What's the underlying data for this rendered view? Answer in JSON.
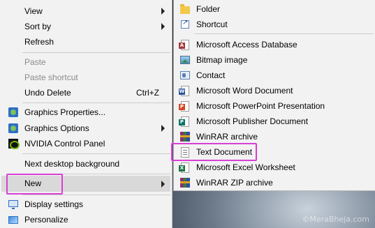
{
  "main_menu": {
    "items": [
      {
        "label": "View",
        "submenu": true
      },
      {
        "label": "Sort by",
        "submenu": true
      },
      {
        "label": "Refresh"
      },
      {
        "label": "Paste",
        "disabled": true
      },
      {
        "label": "Paste shortcut",
        "disabled": true
      },
      {
        "label": "Undo Delete",
        "shortcut": "Ctrl+Z"
      },
      {
        "label": "Graphics Properties...",
        "icon": "graphics-properties-icon"
      },
      {
        "label": "Graphics Options",
        "icon": "graphics-options-icon",
        "submenu": true
      },
      {
        "label": "NVIDIA Control Panel",
        "icon": "nvidia-icon"
      },
      {
        "label": "Next desktop background"
      },
      {
        "label": "New",
        "submenu": true,
        "highlighted": true
      },
      {
        "label": "Display settings",
        "icon": "display-settings-icon"
      },
      {
        "label": "Personalize",
        "icon": "personalize-icon"
      }
    ]
  },
  "new_submenu": {
    "items": [
      {
        "label": "Folder",
        "icon": "folder-icon"
      },
      {
        "label": "Shortcut",
        "icon": "shortcut-icon"
      },
      {
        "label": "Microsoft Access Database",
        "icon": "access-icon",
        "badge": "A"
      },
      {
        "label": "Bitmap image",
        "icon": "bitmap-icon"
      },
      {
        "label": "Contact",
        "icon": "contact-icon"
      },
      {
        "label": "Microsoft Word Document",
        "icon": "word-icon",
        "badge": "W"
      },
      {
        "label": "Microsoft PowerPoint Presentation",
        "icon": "powerpoint-icon",
        "badge": "P"
      },
      {
        "label": "Microsoft Publisher Document",
        "icon": "publisher-icon",
        "badge": "P"
      },
      {
        "label": "WinRAR archive",
        "icon": "winrar-icon"
      },
      {
        "label": "Text Document",
        "icon": "text-document-icon",
        "highlighted": true
      },
      {
        "label": "Microsoft Excel Worksheet",
        "icon": "excel-icon",
        "badge": "X"
      },
      {
        "label": "WinRAR ZIP archive",
        "icon": "winrar-zip-icon"
      }
    ]
  },
  "watermark": "©MeraBheja.com",
  "colors": {
    "menu_bg": "#f2f2f2",
    "highlight_border": "#d93fd6",
    "hover_bg": "#d9d9d9",
    "access": "#a4373a",
    "word": "#2b579a",
    "powerpoint": "#d24726",
    "publisher": "#077568",
    "excel": "#217346"
  }
}
